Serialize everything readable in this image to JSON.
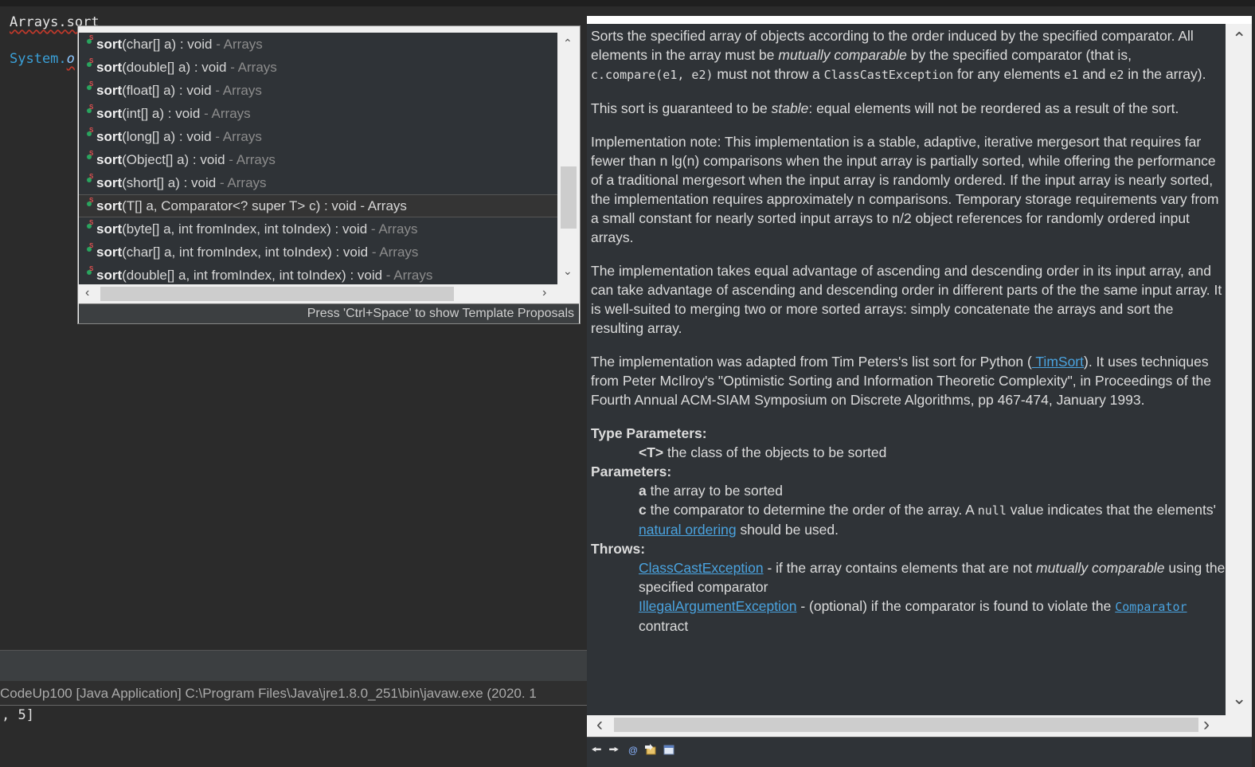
{
  "editor": {
    "line1": "Arrays.sort",
    "line2_prefix": "System.",
    "line2_rest": "o"
  },
  "console": {
    "header": "CodeUp100 [Java Application] C:\\Program Files\\Java\\jre1.8.0_251\\bin\\javaw.exe (2020. 1",
    "output": ", 5]"
  },
  "proposals": {
    "items": [
      {
        "name": "sort",
        "params": "(char[] a) : void",
        "owner": " - Arrays"
      },
      {
        "name": "sort",
        "params": "(double[] a) : void",
        "owner": " - Arrays"
      },
      {
        "name": "sort",
        "params": "(float[] a) : void",
        "owner": " - Arrays"
      },
      {
        "name": "sort",
        "params": "(int[] a) : void",
        "owner": " - Arrays"
      },
      {
        "name": "sort",
        "params": "(long[] a) : void",
        "owner": " - Arrays"
      },
      {
        "name": "sort",
        "params": "(Object[] a) : void",
        "owner": " - Arrays"
      },
      {
        "name": "sort",
        "params": "(short[] a) : void",
        "owner": " - Arrays"
      },
      {
        "name": "sort",
        "params": "(T[] a, Comparator<? super T> c) : void",
        "owner": " - Arrays"
      },
      {
        "name": "sort",
        "params": "(byte[] a, int fromIndex, int toIndex) : void",
        "owner": " - Arrays"
      },
      {
        "name": "sort",
        "params": "(char[] a, int fromIndex, int toIndex) : void",
        "owner": " - Arrays"
      },
      {
        "name": "sort",
        "params": "(double[] a, int fromIndex, int toIndex) : void",
        "owner": " - Arrays"
      }
    ],
    "selected_index": 7,
    "status": "Press 'Ctrl+Space' to show Template Proposals"
  },
  "doc": {
    "p1_a": "Sorts the specified array of objects according to the order induced by the specified comparator. All elements in the array must be ",
    "p1_em": "mutually comparable",
    "p1_b": " by the specified comparator (that is, ",
    "p1_code1": "c.compare(e1, e2)",
    "p1_c": " must not throw a ",
    "p1_code2": "ClassCastException",
    "p1_d": " for any elements ",
    "p1_code3": "e1",
    "p1_e": " and ",
    "p1_code4": "e2",
    "p1_f": " in the array).",
    "p2_a": "This sort is guaranteed to be ",
    "p2_em": "stable",
    "p2_b": ": equal elements will not be reordered as a result of the sort.",
    "p3": "Implementation note: This implementation is a stable, adaptive, iterative mergesort that requires far fewer than n lg(n) comparisons when the input array is partially sorted, while offering the performance of a traditional mergesort when the input array is randomly ordered. If the input array is nearly sorted, the implementation requires approximately n comparisons. Temporary storage requirements vary from a small constant for nearly sorted input arrays to n/2 object references for randomly ordered input arrays.",
    "p4": "The implementation takes equal advantage of ascending and descending order in its input array, and can take advantage of ascending and descending order in different parts of the the same input array. It is well-suited to merging two or more sorted arrays: simply concatenate the arrays and sort the resulting array.",
    "p5_a": "The implementation was adapted from Tim Peters's list sort for Python (",
    "p5_link": " TimSort",
    "p5_b": "). It uses techniques from Peter McIlroy's \"Optimistic Sorting and Information Theoretic Complexity\", in Proceedings of the Fourth Annual ACM-SIAM Symposium on Discrete Algorithms, pp 467-474, January 1993.",
    "type_params_label": "Type Parameters:",
    "tp_name": "<T>",
    "tp_desc": " the class of the objects to be sorted",
    "params_label": "Parameters:",
    "param_a_name": "a",
    "param_a_desc": " the array to be sorted",
    "param_c_name": "c",
    "param_c_desc_a": " the comparator to determine the order of the array. A ",
    "param_c_code": "null",
    "param_c_desc_b": " value indicates that the elements' ",
    "param_c_link": "natural ordering",
    "param_c_desc_c": " should be used.",
    "throws_label": "Throws:",
    "throw1_link": "ClassCastException",
    "throw1_a": " - if the array contains elements that are not ",
    "throw1_em": "mutually comparable",
    "throw1_b": " using the specified comparator",
    "throw2_link": "IllegalArgumentException",
    "throw2_a": " - (optional) if the comparator is found to violate the ",
    "throw2_code": "Comparator",
    "throw2_b": " contract"
  },
  "toolbar_icons": [
    "back-icon",
    "forward-icon",
    "javadoc-icon",
    "open-declaration-icon",
    "open-external-browser-icon"
  ]
}
